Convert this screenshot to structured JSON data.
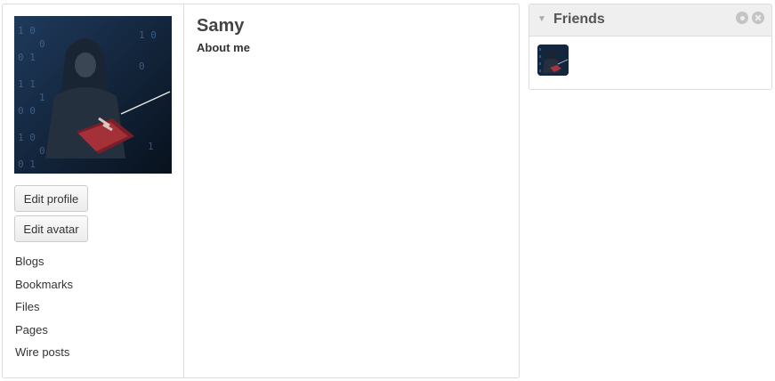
{
  "owner": {
    "name": "Samy",
    "about_label": "About me",
    "avatar_icon": "hacker-avatar-image"
  },
  "buttons": {
    "edit_profile": "Edit profile",
    "edit_avatar": "Edit avatar"
  },
  "menu": {
    "items": [
      "Blogs",
      "Bookmarks",
      "Files",
      "Pages",
      "Wire posts"
    ]
  },
  "friends_widget": {
    "title": "Friends",
    "collapse_icon": "triangle-down-icon",
    "tool_icons": [
      "gear-icon",
      "close-icon"
    ]
  },
  "colors": {
    "border": "#dcdcdc",
    "widget_header": "#efefef",
    "text": "#333333"
  }
}
